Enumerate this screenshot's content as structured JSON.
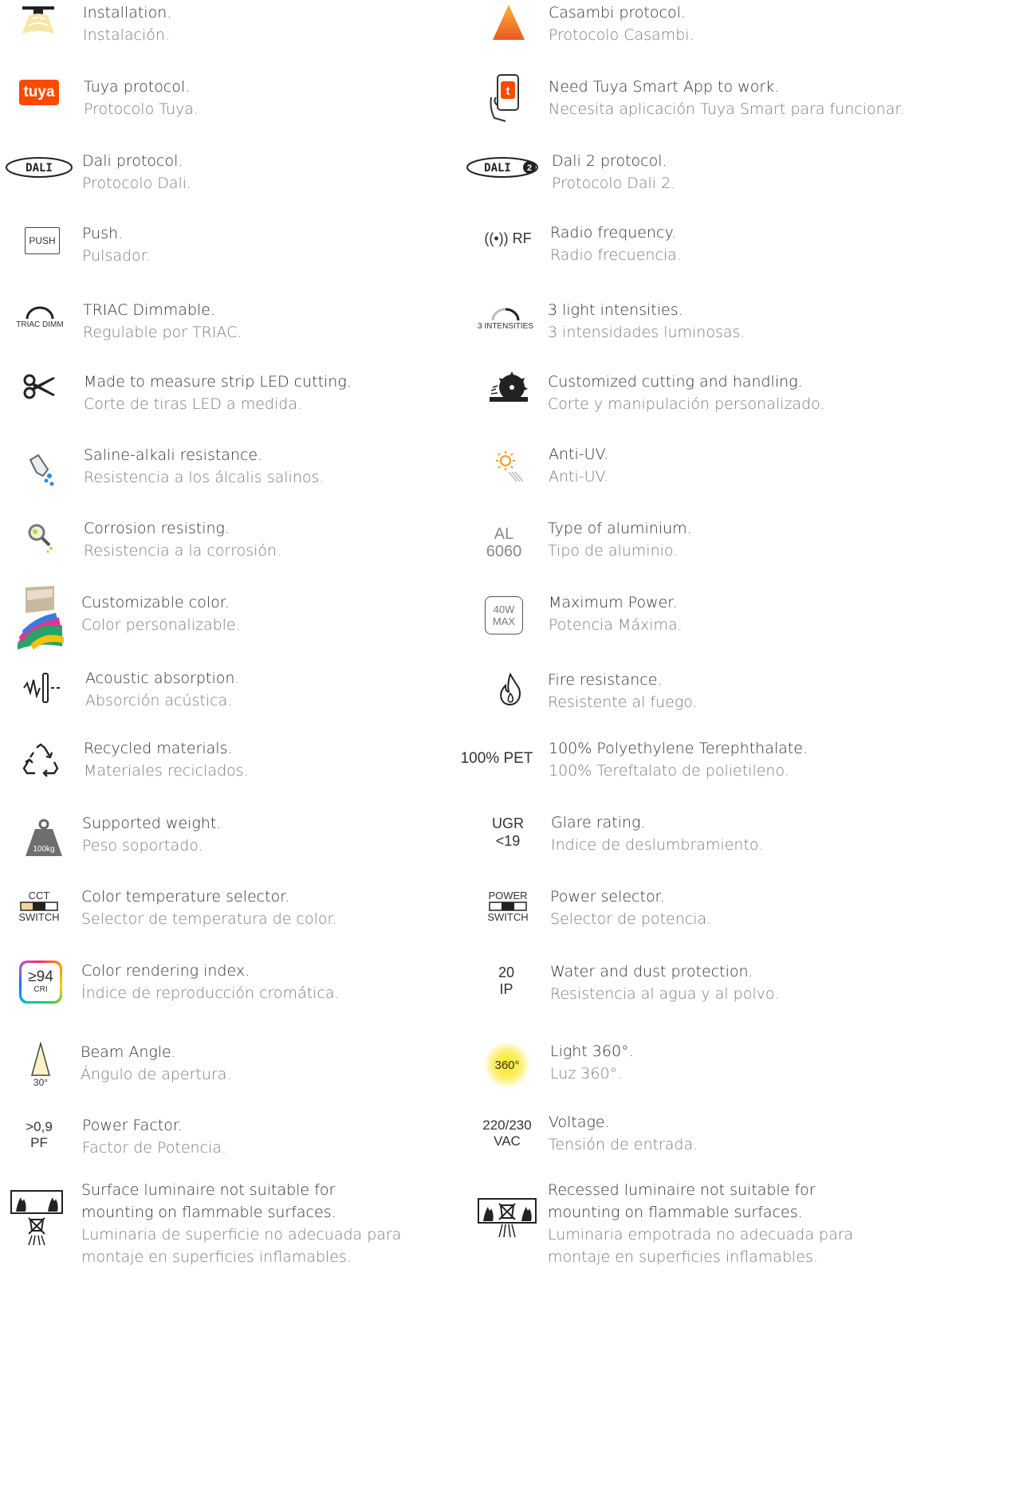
{
  "left": [
    {
      "id": "installation",
      "en": "Installation.",
      "es": "Instalación."
    },
    {
      "id": "tuya",
      "en": "Tuya protocol.",
      "es": "Protocolo Tuya.",
      "icon_text": "tuya"
    },
    {
      "id": "dali",
      "en": "Dali protocol.",
      "es": "Protocolo Dali.",
      "icon_text": "DALI"
    },
    {
      "id": "push",
      "en": "Push.",
      "es": "Pulsador.",
      "icon_text": "PUSH"
    },
    {
      "id": "triac",
      "en": "TRIAC Dimmable.",
      "es": "Regulable por TRIAC.",
      "icon_text": "TRIAC DIMM"
    },
    {
      "id": "strip-cut",
      "en": "Made to measure strip LED cutting.",
      "es": "Corte de tiras LED a medida."
    },
    {
      "id": "saline",
      "en": "Saline-alkali resistance.",
      "es": "Resistencia a los álcalis salinos."
    },
    {
      "id": "corrosion",
      "en": "Corrosion resisting.",
      "es": "Resistencia a la corrosión."
    },
    {
      "id": "color",
      "en": "Customizable color.",
      "es": "Color personalizable."
    },
    {
      "id": "acoustic",
      "en": "Acoustic absorption",
      "en_tail": ".",
      "es": "Absorción acústica."
    },
    {
      "id": "recycled",
      "en": "Recycled materials.",
      "es": "Materiales reciclados."
    },
    {
      "id": "weight",
      "en": "Supported weight.",
      "es": "Peso soportado.",
      "icon_text": "100kg"
    },
    {
      "id": "cct",
      "en": "Color temperature selector.",
      "es": "Selector de temperatura de color.",
      "icon_top": "CCT",
      "icon_bottom": "SWITCH"
    },
    {
      "id": "cri",
      "en": "Color rendering index.",
      "es": "Índice de reproducción cromática.",
      "icon_top": "≥94",
      "icon_bottom": "CRI"
    },
    {
      "id": "beam",
      "en": "Beam Angle.",
      "es": "Ángulo de apertura.",
      "icon_text": "30°"
    },
    {
      "id": "pf",
      "en": "Power Factor.",
      "es": "Factor de Potencia.",
      "icon_top": ">0,9",
      "icon_bottom": "PF"
    },
    {
      "id": "surface",
      "en": "Surface luminaire not suitable for mounting on flammable surfaces.",
      "es": "Luminaria de superficie no adecuada para montaje en superficies inflamables."
    }
  ],
  "right": [
    {
      "id": "casambi",
      "en": "Casambi protocol.",
      "es": "Protocolo Casambi."
    },
    {
      "id": "tuya-app",
      "en": "Need Tuya Smart App to work.",
      "es": "Necesita aplicación Tuya Smart para funcionar."
    },
    {
      "id": "dali2",
      "en": "Dali 2 protocol.",
      "es": "Protocolo Dali 2.",
      "icon_text": "DALI",
      "icon_sup": "2"
    },
    {
      "id": "rf",
      "en": "Radio frequency.",
      "es": "Radio frecuencia.",
      "icon_text": "((•)) RF"
    },
    {
      "id": "intensities",
      "en": "3 light intensities.",
      "es": "3 intensidades luminosas.",
      "icon_text": "3 INTENSITIES"
    },
    {
      "id": "custom-cut",
      "en": "Customized cutting and handling.",
      "es": "Corte y manipulación personalizado."
    },
    {
      "id": "antiuv",
      "en": "Anti-UV.",
      "es": "Anti-UV."
    },
    {
      "id": "aluminium",
      "en": "Type of aluminium.",
      "es": "Tipo de aluminio.",
      "icon_top": "AL",
      "icon_bottom": "6060"
    },
    {
      "id": "maxpower",
      "en": "Maximum Power.",
      "es": "Potencia Máxima.",
      "icon_top": "40W",
      "icon_bottom": "MAX"
    },
    {
      "id": "fire",
      "en": "Fire resistance.",
      "es": "Resistente al fuego."
    },
    {
      "id": "pet",
      "en": "100% Polyethylene Terephthalate.",
      "es": "100% Tereftalato de polietileno.",
      "icon_text": "100% PET"
    },
    {
      "id": "ugr",
      "en": "Glare rating.",
      "es": "Indice de deslumbramiento.",
      "icon_top": "UGR",
      "icon_bottom": "<19"
    },
    {
      "id": "power-switch",
      "en": "Power selector.",
      "es": "Selector de potencia.",
      "icon_top": "POWER",
      "icon_bottom": "SWITCH"
    },
    {
      "id": "ip",
      "en": "Water and dust protection.",
      "es": "Resistencia al agua y al polvo.",
      "icon_top": "20",
      "icon_bottom": "IP"
    },
    {
      "id": "light360",
      "en": "Light 360°.",
      "es": "Luz 360°.",
      "icon_text": "360°"
    },
    {
      "id": "voltage",
      "en": "Voltage.",
      "es": "Tensión de entrada.",
      "icon_top": "220/230",
      "icon_bottom": "VAC"
    },
    {
      "id": "recessed",
      "en": "Recessed luminaire not suitable for mounting on flammable surfaces.",
      "es": "Luminaria empotrada no adecuada para montaje en superficies inflamables."
    }
  ],
  "colors": {
    "text_en": "#2f2f2f",
    "text_es": "#7a7a7a",
    "tuya_orange": "#ff4800",
    "casambi_orange": "#f57c1f",
    "glow_yellow": "#f8e71c"
  }
}
